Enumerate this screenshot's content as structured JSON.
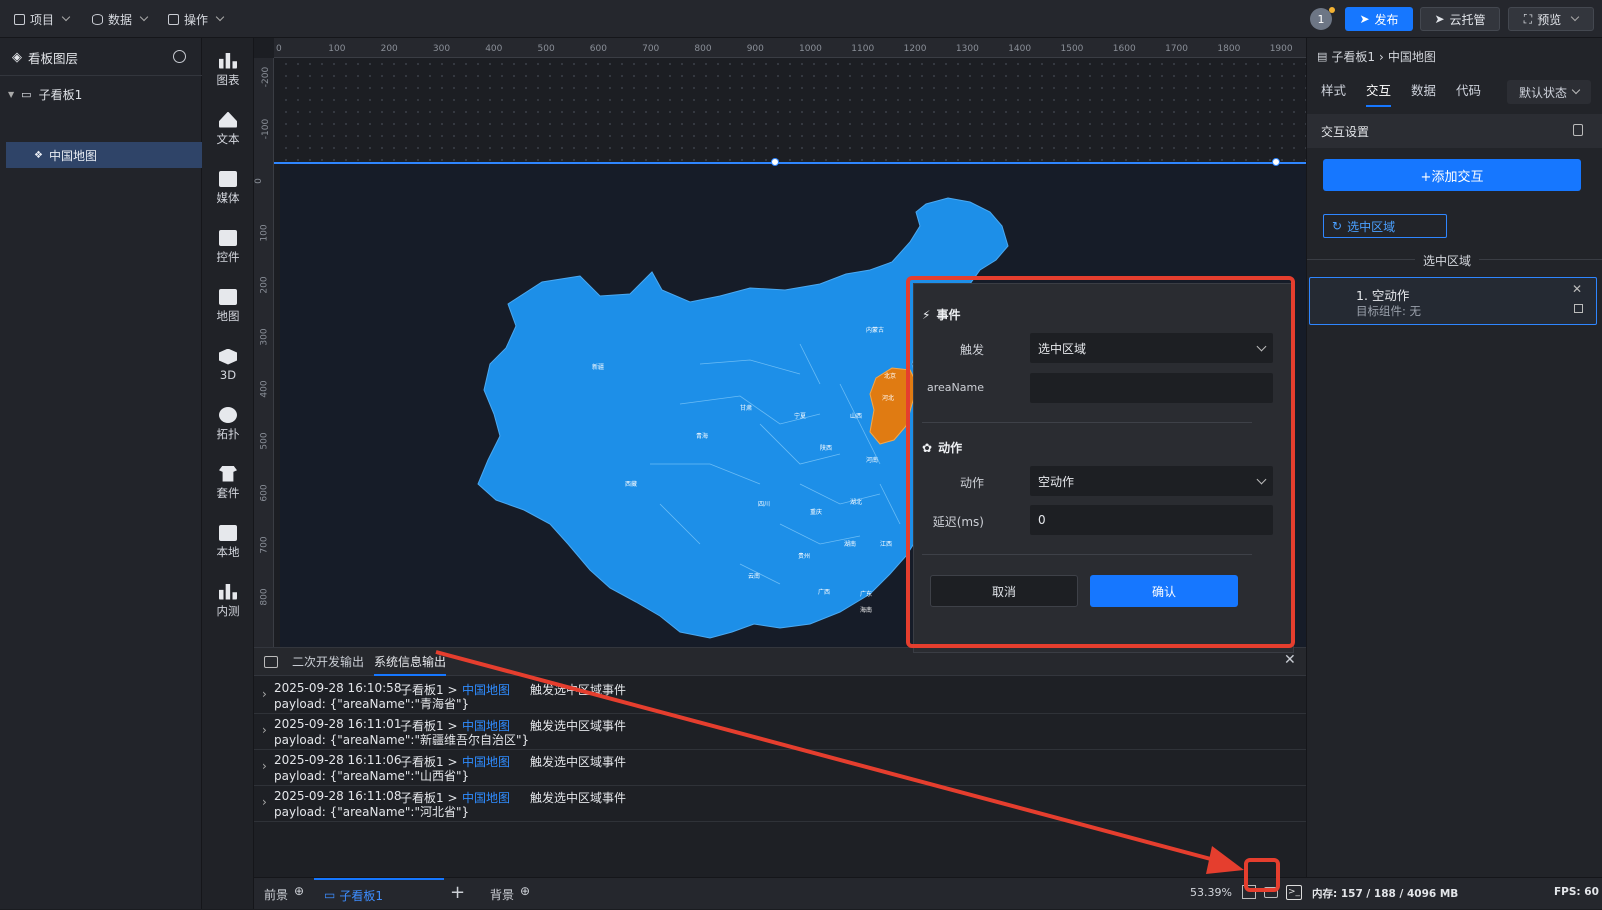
{
  "topbar": {
    "menus": [
      "项目",
      "数据",
      "操作"
    ],
    "badge": "1",
    "publish": "发布",
    "cloud": "云托管",
    "preview": "预览"
  },
  "layers": {
    "title": "看板图层",
    "board": "子看板1",
    "item": "中国地图"
  },
  "tools": [
    "图表",
    "文本",
    "媒体",
    "控件",
    "地图",
    "3D",
    "拓扑",
    "套件",
    "本地",
    "内测"
  ],
  "ruler": {
    "top": [
      "0",
      "100",
      "200",
      "300",
      "400",
      "500",
      "600",
      "700",
      "800",
      "900",
      "1000",
      "1100",
      "1200",
      "1300",
      "1400",
      "1500",
      "1600",
      "1700",
      "1800",
      "1900"
    ],
    "left": [
      "-200",
      "-100",
      "0",
      "100",
      "200",
      "300",
      "400",
      "500",
      "600",
      "700",
      "800"
    ]
  },
  "map": {
    "labels": [
      "新疆",
      "西藏",
      "青海",
      "甘肃",
      "内蒙古",
      "宁夏",
      "陕西",
      "山西",
      "河北",
      "北京",
      "河南",
      "湖北",
      "四川",
      "重庆",
      "湖南",
      "贵州",
      "云南",
      "广西",
      "江西",
      "广东",
      "海南"
    ],
    "fill_color": "#1d8fe8",
    "highlight_color": "#e07b12"
  },
  "right": {
    "breadcrumb_root": "子看板1",
    "breadcrumb_leaf": "中国地图",
    "tabs": [
      "样式",
      "交互",
      "数据",
      "代码"
    ],
    "active_tab": "交互",
    "state": "默认状态",
    "section_title": "交互设置",
    "add_button": "+添加交互",
    "event_tag": "选中区域",
    "divider_label": "选中区域",
    "action_title": "1. 空动作",
    "action_target": "目标组件: 无"
  },
  "modal": {
    "event_title": "事件",
    "trigger_label": "触发",
    "trigger_value": "选中区域",
    "area_label": "areaName",
    "area_value": "",
    "action_title": "动作",
    "action_label": "动作",
    "action_value": "空动作",
    "delay_label": "延迟(ms)",
    "delay_value": "0",
    "cancel": "取消",
    "confirm": "确认"
  },
  "console": {
    "tabs": [
      "二次开发输出",
      "系统信息输出"
    ],
    "active_tab": "系统信息输出",
    "rows": [
      {
        "time": "2025-09-28 16:10:58",
        "board": "子看板1 >",
        "comp": "中国地图",
        "msg": "触发选中区域事件",
        "payload": "payload: {\"areaName\":\"青海省\"}"
      },
      {
        "time": "2025-09-28 16:11:01",
        "board": "子看板1 >",
        "comp": "中国地图",
        "msg": "触发选中区域事件",
        "payload": "payload: {\"areaName\":\"新疆维吾尔自治区\"}"
      },
      {
        "time": "2025-09-28 16:11:06",
        "board": "子看板1 >",
        "comp": "中国地图",
        "msg": "触发选中区域事件",
        "payload": "payload: {\"areaName\":\"山西省\"}"
      },
      {
        "time": "2025-09-28 16:11:08",
        "board": "子看板1 >",
        "comp": "中国地图",
        "msg": "触发选中区域事件",
        "payload": "payload: {\"areaName\":\"河北省\"}"
      }
    ]
  },
  "footer": {
    "front": "前景",
    "board": "子看板1",
    "back": "背景",
    "zoom": "53.39%",
    "memory": "内存: 157 / 188 / 4096 MB",
    "fps": "FPS: 60"
  }
}
